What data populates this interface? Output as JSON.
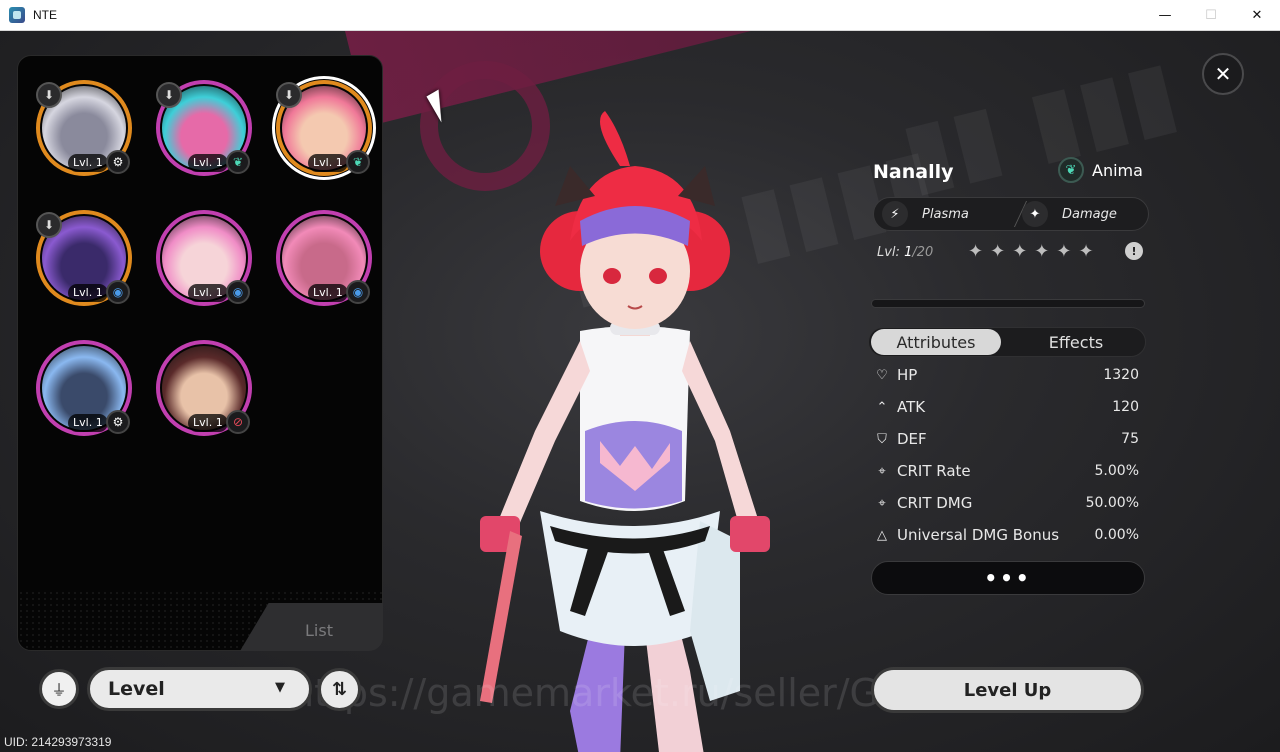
{
  "window": {
    "title": "NTE",
    "minimize": "—",
    "maximize": "☐",
    "close": "✕"
  },
  "roster": {
    "list_label": "List",
    "characters": [
      {
        "level": "Lvl. 1",
        "frame": "orange",
        "element": "gear",
        "download": true,
        "selected": false,
        "palette": [
          "#d6d6e0",
          "#8a8a9c"
        ]
      },
      {
        "level": "Lvl. 1",
        "frame": "purple",
        "element": "leaf",
        "download": true,
        "selected": false,
        "palette": [
          "#3ecfd8",
          "#e66aa8"
        ]
      },
      {
        "level": "Lvl. 1",
        "frame": "orange",
        "element": "leaf",
        "download": true,
        "selected": true,
        "palette": [
          "#f07898",
          "#f4c9b0"
        ]
      },
      {
        "level": "Lvl. 1",
        "frame": "orange",
        "element": "swirl",
        "download": true,
        "selected": false,
        "palette": [
          "#8a5ad0",
          "#3a2a6a"
        ]
      },
      {
        "level": "Lvl. 1",
        "frame": "purple",
        "element": "swirl",
        "download": false,
        "selected": false,
        "palette": [
          "#f08cc6",
          "#f6d4d8"
        ]
      },
      {
        "level": "Lvl. 1",
        "frame": "purple",
        "element": "swirl",
        "download": false,
        "selected": false,
        "palette": [
          "#f28ab8",
          "#c86a8a"
        ]
      },
      {
        "level": "Lvl. 1",
        "frame": "purple",
        "element": "gear",
        "download": false,
        "selected": false,
        "palette": [
          "#8ab8f0",
          "#3a4a6a"
        ]
      },
      {
        "level": "Lvl. 1",
        "frame": "purple",
        "element": "target",
        "download": false,
        "selected": false,
        "palette": [
          "#5a2a2a",
          "#e8c2a8"
        ]
      }
    ]
  },
  "controls": {
    "sort_label": "Level",
    "watermark": "https://gamemarket.ru/seller/GameNexus",
    "uid": "UID: 214293973319"
  },
  "character": {
    "name": "Nanally",
    "affinity": "Anima",
    "tag1": "Plasma",
    "tag2": "Damage",
    "level_prefix": "Lvl: ",
    "level_current": "1",
    "level_max": "/20",
    "stars": 6,
    "xp_fraction": 0.0
  },
  "stats": {
    "tab_attributes": "Attributes",
    "tab_effects": "Effects",
    "rows": [
      {
        "icon": "heart-icon",
        "glyph": "♡",
        "name": "HP",
        "value": "1320"
      },
      {
        "icon": "atk-icon",
        "glyph": "⌃",
        "name": "ATK",
        "value": "120"
      },
      {
        "icon": "shield-icon",
        "glyph": "⛉",
        "name": "DEF",
        "value": "75"
      },
      {
        "icon": "crosshair-icon",
        "glyph": "⌖",
        "name": "CRIT Rate",
        "value": "5.00%"
      },
      {
        "icon": "crosshair-icon",
        "glyph": "⌖",
        "name": "CRIT DMG",
        "value": "50.00%"
      },
      {
        "icon": "triangle-icon",
        "glyph": "△",
        "name": "Universal DMG Bonus",
        "value": "0.00%"
      }
    ],
    "more": "•••"
  },
  "buttons": {
    "level_up": "Level Up"
  },
  "colors": {
    "frame_orange": "#e08a1e",
    "frame_purple": "#c13fb0",
    "anima": "#4ed8b6"
  }
}
